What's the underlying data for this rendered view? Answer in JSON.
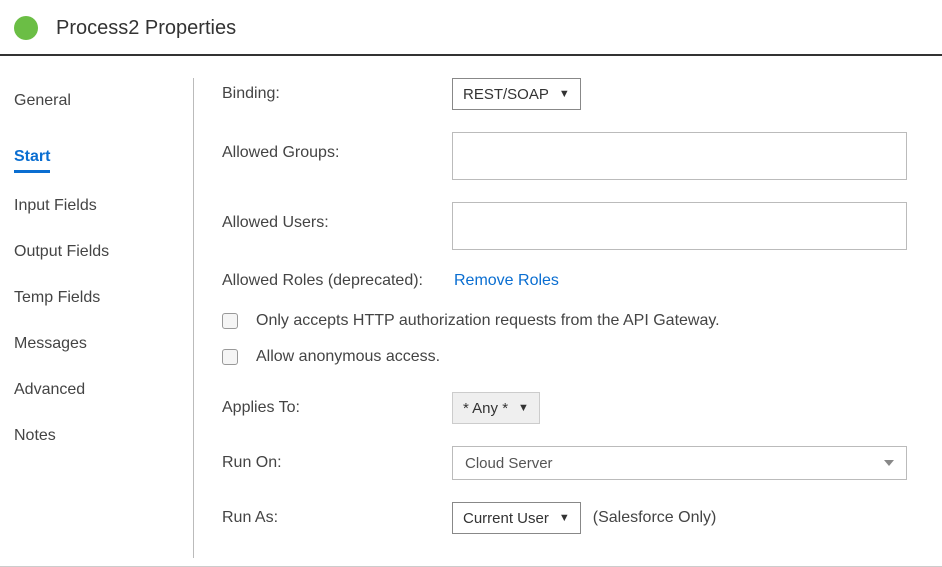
{
  "header": {
    "title": "Process2 Properties"
  },
  "sidebar": {
    "items": [
      {
        "label": "General",
        "active": false
      },
      {
        "label": "Start",
        "active": true
      },
      {
        "label": "Input Fields",
        "active": false
      },
      {
        "label": "Output Fields",
        "active": false
      },
      {
        "label": "Temp Fields",
        "active": false
      },
      {
        "label": "Messages",
        "active": false
      },
      {
        "label": "Advanced",
        "active": false
      },
      {
        "label": "Notes",
        "active": false
      }
    ]
  },
  "form": {
    "binding_label": "Binding:",
    "binding_value": "REST/SOAP",
    "allowed_groups_label": "Allowed Groups:",
    "allowed_groups_value": "",
    "allowed_users_label": "Allowed Users:",
    "allowed_users_value": "",
    "allowed_roles_label": "Allowed Roles (deprecated):",
    "remove_roles_label": "Remove Roles",
    "checkbox1_label": "Only accepts HTTP authorization requests from the API Gateway.",
    "checkbox2_label": "Allow anonymous access.",
    "applies_to_label": "Applies To:",
    "applies_to_value": "* Any *",
    "run_on_label": "Run On:",
    "run_on_value": "Cloud Server",
    "run_as_label": "Run As:",
    "run_as_value": "Current User",
    "run_as_hint": "(Salesforce Only)"
  }
}
